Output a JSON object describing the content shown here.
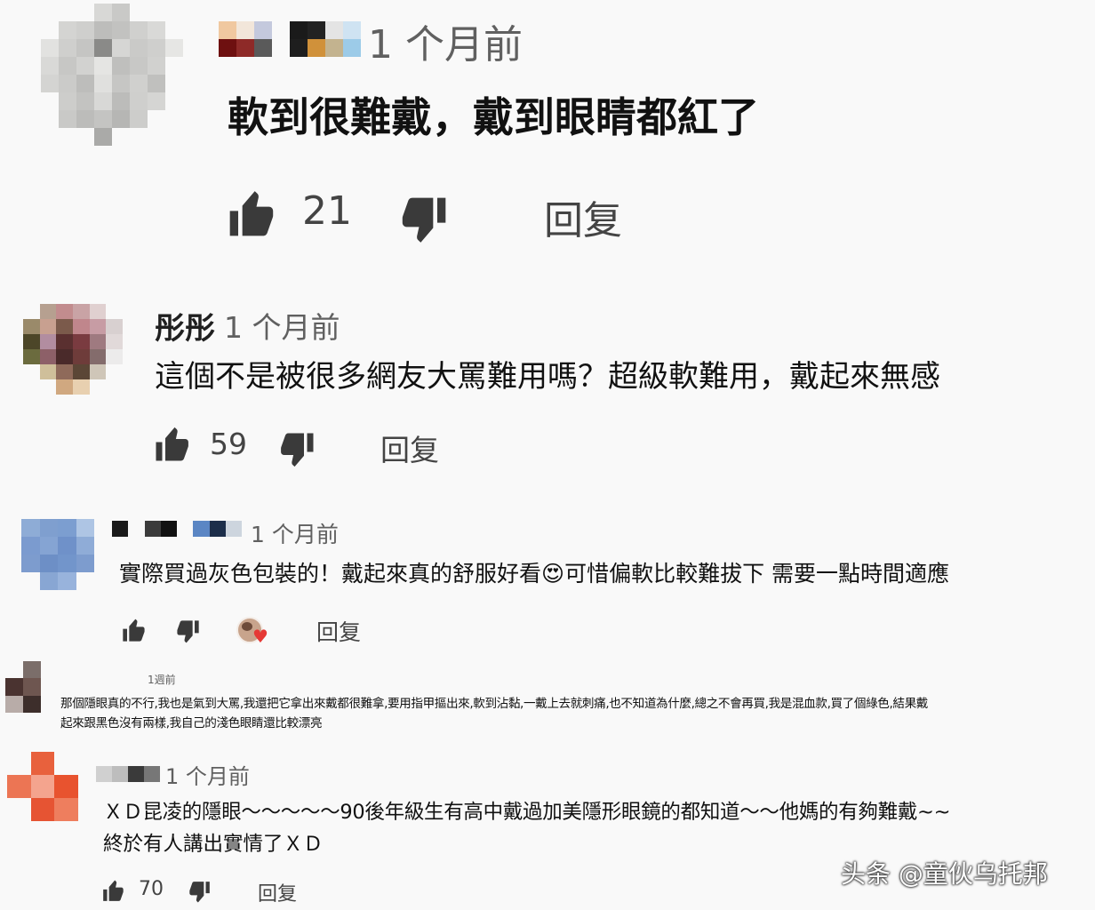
{
  "comments": [
    {
      "name": "",
      "time": "1 个月前",
      "text": "軟到很難戴，戴到眼睛都紅了",
      "likes": "21",
      "reply": "回复"
    },
    {
      "name": "彤彤",
      "time": "1 个月前",
      "text": "這個不是被很多網友大罵難用嗎？超級軟難用，戴起來無感",
      "likes": "59",
      "reply": "回复"
    },
    {
      "name": "",
      "time": "1 个月前",
      "text": "實際買過灰色包裝的！戴起來真的舒服好看😍可惜偏軟比較難拔下 需要一點時間適應",
      "likes": "",
      "reply": "回复",
      "creator_heart": "heart-badge"
    },
    {
      "name": "",
      "time": "1週前",
      "text_line1": "那個隱眼真的不行,我也是氣到大罵,我還把它拿出來戴都很難拿,要用指甲摳出來,軟到沾黏,一戴上去就刺痛,也不知道為什麼,總之不會再買,我是混血款,買了個綠色,結果戴",
      "text_line2": "起來跟黑色沒有兩樣,我自己的淺色眼睛還比較漂亮"
    },
    {
      "name": "",
      "time": "1 个月前",
      "text_line1": "ＸＤ昆凌的隱眼～～～～～90後年級生有高中戴過加美隱形眼鏡的都知道～～他媽的有夠難戴~~",
      "text_line2": "終於有人講出實情了ＸＤ",
      "likes": "70",
      "reply": "回复"
    }
  ],
  "watermark": "头条 @童伙乌托邦",
  "icons": {
    "like": "thumbs-up-icon",
    "dislike": "thumbs-down-icon"
  },
  "colors": {
    "background": "#f9f9f9",
    "icon": "#3a3a3a",
    "heart": "#e53935"
  }
}
